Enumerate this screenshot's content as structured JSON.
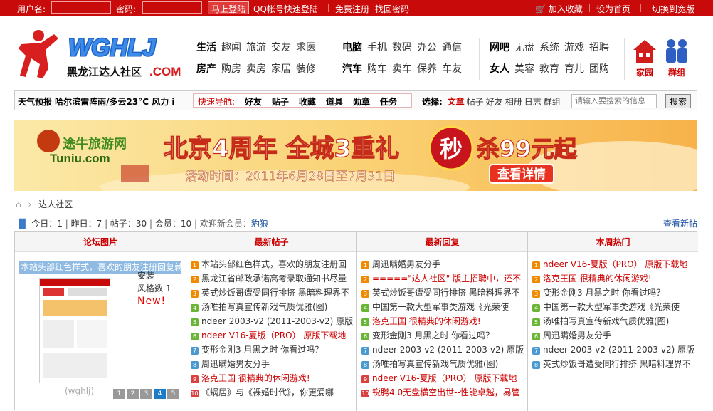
{
  "topbar": {
    "username_label": "用户名:",
    "password_label": "密码:",
    "login_btn": "马上登陆",
    "qq_login": "QQ帐号快速登陆",
    "register": "免费注册",
    "find_pwd": "找回密码",
    "favorite": "加入收藏",
    "homepage": "设为首页",
    "wide": "切换到宽版"
  },
  "logo": {
    "text": "WGHLJ",
    "sub": "黑龙江达人社区",
    "com": ".COM"
  },
  "nav": {
    "g1": {
      "r1": [
        "生活",
        "趣闻",
        "旅游",
        "交友",
        "求医"
      ],
      "r2": [
        "房产",
        "购房",
        "卖房",
        "家居",
        "装修"
      ]
    },
    "g2": {
      "r1": [
        "电脑",
        "手机",
        "数码",
        "办公",
        "通信"
      ],
      "r2": [
        "汽车",
        "购车",
        "卖车",
        "保养",
        "车友"
      ]
    },
    "g3": {
      "r1": [
        "网吧",
        "无盘",
        "系统",
        "游戏",
        "招聘"
      ],
      "r2": [
        "女人",
        "美容",
        "教育",
        "育儿",
        "团购"
      ]
    }
  },
  "icons": {
    "home_label": "家园",
    "group_label": "群组"
  },
  "toolbar": {
    "weather": "天气预报  哈尔滨雷阵雨/多云23°C 风力 i",
    "quick_title": "快速导航:",
    "quick_items": [
      "好友",
      "贴子",
      "收藏",
      "道具",
      "勋章",
      "任务"
    ],
    "choose_title": "选择:",
    "choose_items": [
      "文章",
      "帖子",
      "好友",
      "相册",
      "日志",
      "群组"
    ],
    "search_placeholder": "请输入要搜索的信息",
    "search_btn": "搜索"
  },
  "banner": {
    "logo": "途牛旅游网",
    "logo_en": "Tuniu.com",
    "title": "北京4周年 全城3重礼",
    "badge": "秒",
    "offer": "杀99元起",
    "time": "活动时间：2011年6月28日至7月31日",
    "detail_btn": "查看详情"
  },
  "breadcrumb": {
    "current": "达人社区"
  },
  "stats": {
    "today": "今日：1",
    "yesterday": "昨日：7",
    "posts": "帖子：30",
    "members": "会员：10",
    "welcome": "欢迎新会员：",
    "newest": "豹狼",
    "view_new": "查看新帖"
  },
  "columns": {
    "pics": {
      "title": "论坛图片",
      "caption": "本站头部红色样式，喜欢的朋友注册回复就",
      "side1": "安装",
      "side2": "风格数 1",
      "side3": "New!",
      "foot": "(wghlj)",
      "pages": [
        "1",
        "2",
        "3",
        "4",
        "5"
      ]
    },
    "new_posts": {
      "title": "最新帖子",
      "items": [
        "本站头部红色样式，喜欢的朋友注册回",
        "黑龙江省邮政承诺高考录取通知书尽量",
        "英式炒饭哥遭受同行排挤 黑暗料理界不",
        "汤唯拍写真宣传新戏气质优雅(图)",
        "ndeer 2003-v2 (2011-2003-v2) 原版",
        "ndeer V16-夏版（PRO） 原版下载地",
        "变形金刚3 月黑之时 你看过吗？",
        "周迅瞒婚男友分手",
        "洛克王国 很精典的休闲游戏!",
        "《蜗居》与《裸婚时代》，你更爱哪一"
      ]
    },
    "new_replies": {
      "title": "最新回复",
      "items": [
        "周迅瞒婚男友分手",
        "=====\"达人社区\" 版主招聘中，还不",
        "英式炒饭哥遭受同行排挤 黑暗料理界不",
        "中国第一款大型军事类游戏《光荣使",
        "洛克王国 很精典的休闲游戏!",
        "变形金刚3 月黑之时 你看过吗？",
        "ndeer 2003-v2 (2011-2003-v2) 原版",
        "汤唯拍写真宣传新戏气质优雅(图)",
        "ndeer V16-夏版（PRO） 原版下载地",
        "锐腾4.0无盘横空出世--性能卓越，易管"
      ]
    },
    "hot": {
      "title": "本周热门",
      "items": [
        "ndeer V16-夏版（PRO） 原版下载地",
        "洛克王国 很精典的休闲游戏!",
        "变形金刚3 月黑之时 你看过吗？",
        "中国第一款大型军事类游戏《光荣使",
        "汤唯拍写真宣传新戏气质优雅(图)",
        "周迅瞒婚男友分手",
        "ndeer 2003-v2 (2011-2003-v2) 原版",
        "英式炒饭哥遭受同行排挤 黑暗料理界不"
      ]
    }
  },
  "colors": {
    "brand_red": "#c80a0a",
    "link_blue": "#1a4fa0",
    "rank_orange": "#f08a00",
    "rank_green": "#6bb536",
    "rank_blue": "#4a9ad0",
    "rank_red": "#d94040"
  }
}
